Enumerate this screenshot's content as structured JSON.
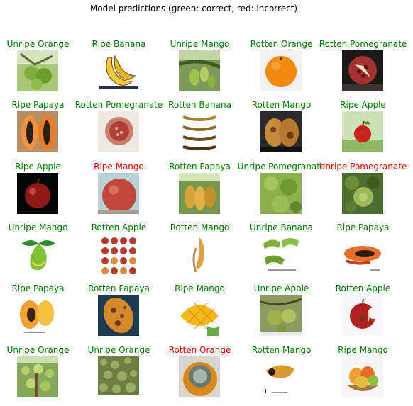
{
  "title": "Model predictions (green: correct, red: incorrect)",
  "colors": {
    "correct": "#008000",
    "incorrect": "#ff0000"
  },
  "predictions": [
    {
      "label": "Unripe Orange",
      "correct": true,
      "icon": "green-citrus-on-branch"
    },
    {
      "label": "Ripe Banana",
      "correct": true,
      "icon": "yellow-banana-bunch"
    },
    {
      "label": "Unripe Mango",
      "correct": true,
      "icon": "green-mangoes-on-tree"
    },
    {
      "label": "Rotten Orange",
      "correct": true,
      "icon": "orange-fruit"
    },
    {
      "label": "Rotten Pomegranate",
      "correct": true,
      "icon": "split-pomegranate-dark"
    },
    {
      "label": "Ripe Papaya",
      "correct": true,
      "icon": "papaya-halves"
    },
    {
      "label": "Rotten Pomegranate",
      "correct": true,
      "icon": "pomegranate-half"
    },
    {
      "label": "Rotten Banana",
      "correct": true,
      "icon": "brown-bananas-stages"
    },
    {
      "label": "Rotten Mango",
      "correct": true,
      "icon": "rotten-mango-halves"
    },
    {
      "label": "Ripe Apple",
      "correct": true,
      "icon": "red-apple-green-bg"
    },
    {
      "label": "Ripe Apple",
      "correct": true,
      "icon": "red-apple-black-bg"
    },
    {
      "label": "Ripe Mango",
      "correct": false,
      "icon": "red-fruit-closeup"
    },
    {
      "label": "Rotten Papaya",
      "correct": true,
      "icon": "papayas-on-tree"
    },
    {
      "label": "Unripe Pomegranate",
      "correct": true,
      "icon": "pomegranate-leaves"
    },
    {
      "label": "Unripe Pomegranate",
      "correct": false,
      "icon": "green-fruit-foliage"
    },
    {
      "label": "Unripe Mango",
      "correct": true,
      "icon": "green-mango-leaves"
    },
    {
      "label": "Rotten Apple",
      "correct": true,
      "icon": "apple-grid"
    },
    {
      "label": "Rotten Mango",
      "correct": true,
      "icon": "mango-slices-white"
    },
    {
      "label": "Unripe Banana",
      "correct": true,
      "icon": "green-banana-bunches"
    },
    {
      "label": "Ripe Papaya",
      "correct": true,
      "icon": "papaya-cut-open"
    },
    {
      "label": "Ripe Papaya",
      "correct": true,
      "icon": "papaya-halves-white"
    },
    {
      "label": "Rotten Papaya",
      "correct": true,
      "icon": "spotted-papaya"
    },
    {
      "label": "Ripe Mango",
      "correct": true,
      "icon": "mango-cubes"
    },
    {
      "label": "Unripe Apple",
      "correct": true,
      "icon": "green-apples-tree"
    },
    {
      "label": "Rotten Apple",
      "correct": true,
      "icon": "bitten-apple"
    },
    {
      "label": "Unripe Orange",
      "correct": true,
      "icon": "green-oranges-tree"
    },
    {
      "label": "Unripe Orange",
      "correct": true,
      "icon": "green-foliage-texture"
    },
    {
      "label": "Rotten Orange",
      "correct": false,
      "icon": "moldy-orange"
    },
    {
      "label": "Rotten Mango",
      "correct": true,
      "icon": "rotten-mango-piece"
    },
    {
      "label": "Ripe Mango",
      "correct": true,
      "icon": "mango-bowl"
    }
  ]
}
